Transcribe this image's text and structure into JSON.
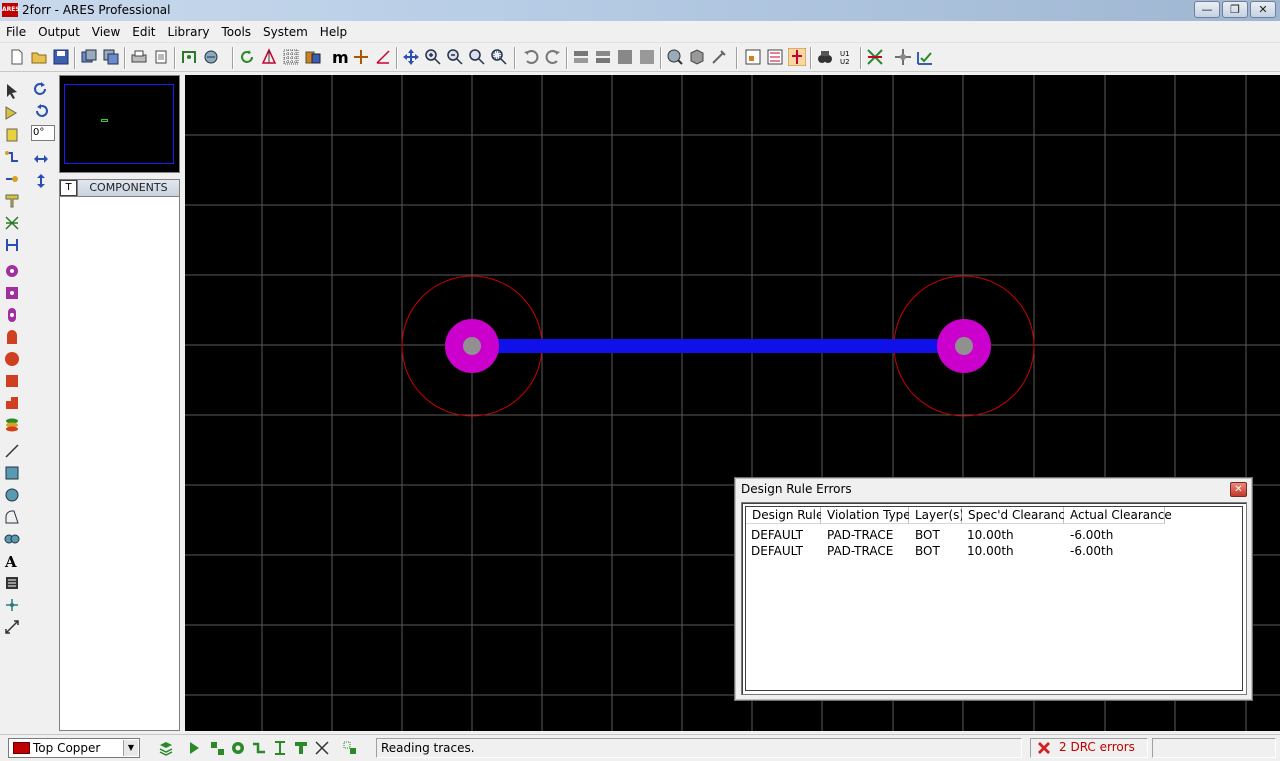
{
  "window": {
    "app_icon_text": "ARES",
    "title": "2forr - ARES Professional",
    "minimize": "—",
    "maximize": "❐",
    "close": "✕"
  },
  "menu": [
    "File",
    "Output",
    "View",
    "Edit",
    "Library",
    "Tools",
    "System",
    "Help"
  ],
  "left_panel": {
    "rotation_value": "0°",
    "selector_tab": "T",
    "components_label": "COMPONENTS"
  },
  "board": {
    "colors": {
      "background": "#000000",
      "grid": "#5a5a5a",
      "trace": "#1010e8",
      "pad": "#cc00cc",
      "pad_hole": "#909090",
      "clearance_ring": "#cc0000"
    }
  },
  "drc_dialog": {
    "title": "Design Rule Errors",
    "close": "✕",
    "columns": [
      "Design Rule",
      "Violation Type",
      "Layer(s)",
      "Spec'd Clearance",
      "Actual Clearance"
    ],
    "rows": [
      [
        "DEFAULT",
        "PAD-TRACE",
        "BOT",
        "10.00th",
        "-6.00th"
      ],
      [
        "DEFAULT",
        "PAD-TRACE",
        "BOT",
        "10.00th",
        "-6.00th"
      ]
    ]
  },
  "status": {
    "layer": "Top Copper",
    "layer_color": "#c00000",
    "message": "Reading traces.",
    "drc_errors": "2 DRC errors"
  }
}
